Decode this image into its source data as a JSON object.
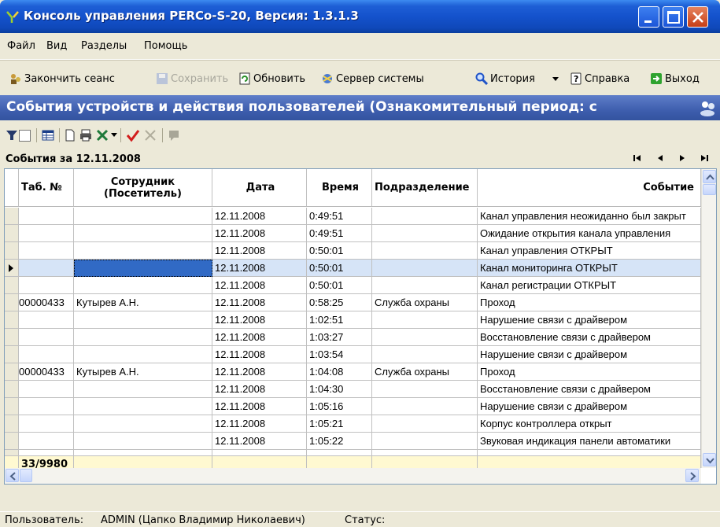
{
  "window": {
    "title": "Консоль управления PERCo-S-20, Версия: 1.3.1.3"
  },
  "menu": [
    "Файл",
    "Вид",
    "Разделы",
    "Помощь"
  ],
  "toolbar": {
    "end_session": "Закончить сеанс",
    "save": "Сохранить",
    "refresh": "Обновить",
    "server": "Сервер системы",
    "history": "История",
    "help": "Справка",
    "exit": "Выход"
  },
  "section": {
    "title": "События устройств и действия пользователей (Ознакомительный период: с"
  },
  "date_group": "События за 12.11.2008",
  "grid": {
    "columns": [
      "Таб. №",
      "Сотрудник (Посетитель)",
      "Дата",
      "Время",
      "Подразделение",
      "Событие"
    ],
    "rows": [
      {
        "tab": "",
        "employee": "",
        "date": "12.11.2008",
        "time": "0:49:51",
        "dept": "",
        "event": "Канал управления неожиданно был закрыт"
      },
      {
        "tab": "",
        "employee": "",
        "date": "12.11.2008",
        "time": "0:49:51",
        "dept": "",
        "event": "Ожидание открытия канала управления"
      },
      {
        "tab": "",
        "employee": "",
        "date": "12.11.2008",
        "time": "0:50:01",
        "dept": "",
        "event": "Канал управления ОТКРЫТ"
      },
      {
        "tab": "",
        "employee": "",
        "date": "12.11.2008",
        "time": "0:50:01",
        "dept": "",
        "event": "Канал мониторинга ОТКРЫТ"
      },
      {
        "tab": "",
        "employee": "",
        "date": "12.11.2008",
        "time": "0:50:01",
        "dept": "",
        "event": "Канал регистрации ОТКРЫТ"
      },
      {
        "tab": "00000433",
        "employee": "Кутырев А.Н.",
        "date": "12.11.2008",
        "time": "0:58:25",
        "dept": "Служба охраны",
        "event": "Проход"
      },
      {
        "tab": "",
        "employee": "",
        "date": "12.11.2008",
        "time": "1:02:51",
        "dept": "",
        "event": "Нарушение связи с драйвером"
      },
      {
        "tab": "",
        "employee": "",
        "date": "12.11.2008",
        "time": "1:03:27",
        "dept": "",
        "event": "Восстановление связи с драйвером"
      },
      {
        "tab": "",
        "employee": "",
        "date": "12.11.2008",
        "time": "1:03:54",
        "dept": "",
        "event": "Нарушение связи с драйвером"
      },
      {
        "tab": "00000433",
        "employee": "Кутырев А.Н.",
        "date": "12.11.2008",
        "time": "1:04:08",
        "dept": "Служба охраны",
        "event": "Проход"
      },
      {
        "tab": "",
        "employee": "",
        "date": "12.11.2008",
        "time": "1:04:30",
        "dept": "",
        "event": "Восстановление связи с драйвером"
      },
      {
        "tab": "",
        "employee": "",
        "date": "12.11.2008",
        "time": "1:05:16",
        "dept": "",
        "event": "Нарушение связи с драйвером"
      },
      {
        "tab": "",
        "employee": "",
        "date": "12.11.2008",
        "time": "1:05:21",
        "dept": "",
        "event": "Корпус контроллера открыт"
      },
      {
        "tab": "",
        "employee": "",
        "date": "12.11.2008",
        "time": "1:05:22",
        "dept": "",
        "event": "Звуковая индикация панели автоматики"
      }
    ],
    "footer_count": "33/9980"
  },
  "status": {
    "user_label": "Пользователь:",
    "user": "ADMIN (Цапко Владимир Николаевич)",
    "status_label": "Статус:"
  }
}
